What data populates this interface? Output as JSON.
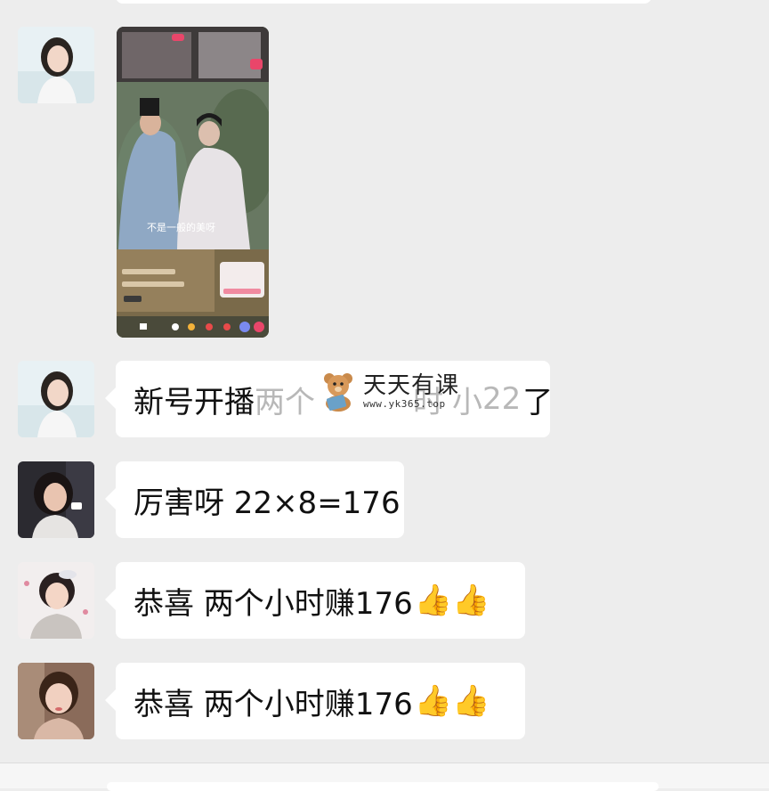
{
  "messages": [
    {
      "type": "video",
      "avatar": "avatar-woman-white-dress",
      "video": {
        "subtitle": "不是一般的美呀"
      }
    },
    {
      "type": "text",
      "avatar": "avatar-woman-white-dress",
      "text_visible": "新号开播",
      "text_faded": "两个",
      "text_faded2": "时",
      "text_faded3": "小",
      "text_faded4": "22",
      "text_end": "了"
    },
    {
      "type": "text",
      "avatar": "avatar-woman-dark-hair",
      "text": "厉害呀 22×8=176"
    },
    {
      "type": "text",
      "avatar": "avatar-woman-smiling",
      "text": "恭喜 两个小时赚176",
      "emoji": "👍👍"
    },
    {
      "type": "text",
      "avatar": "avatar-woman-selfie",
      "text": "恭喜 两个小时赚176",
      "emoji": "👍👍"
    }
  ],
  "watermark": {
    "title": "天天有课",
    "url": "www.yk365.top"
  },
  "colors": {
    "background": "#ededed",
    "bubble": "#ffffff"
  }
}
